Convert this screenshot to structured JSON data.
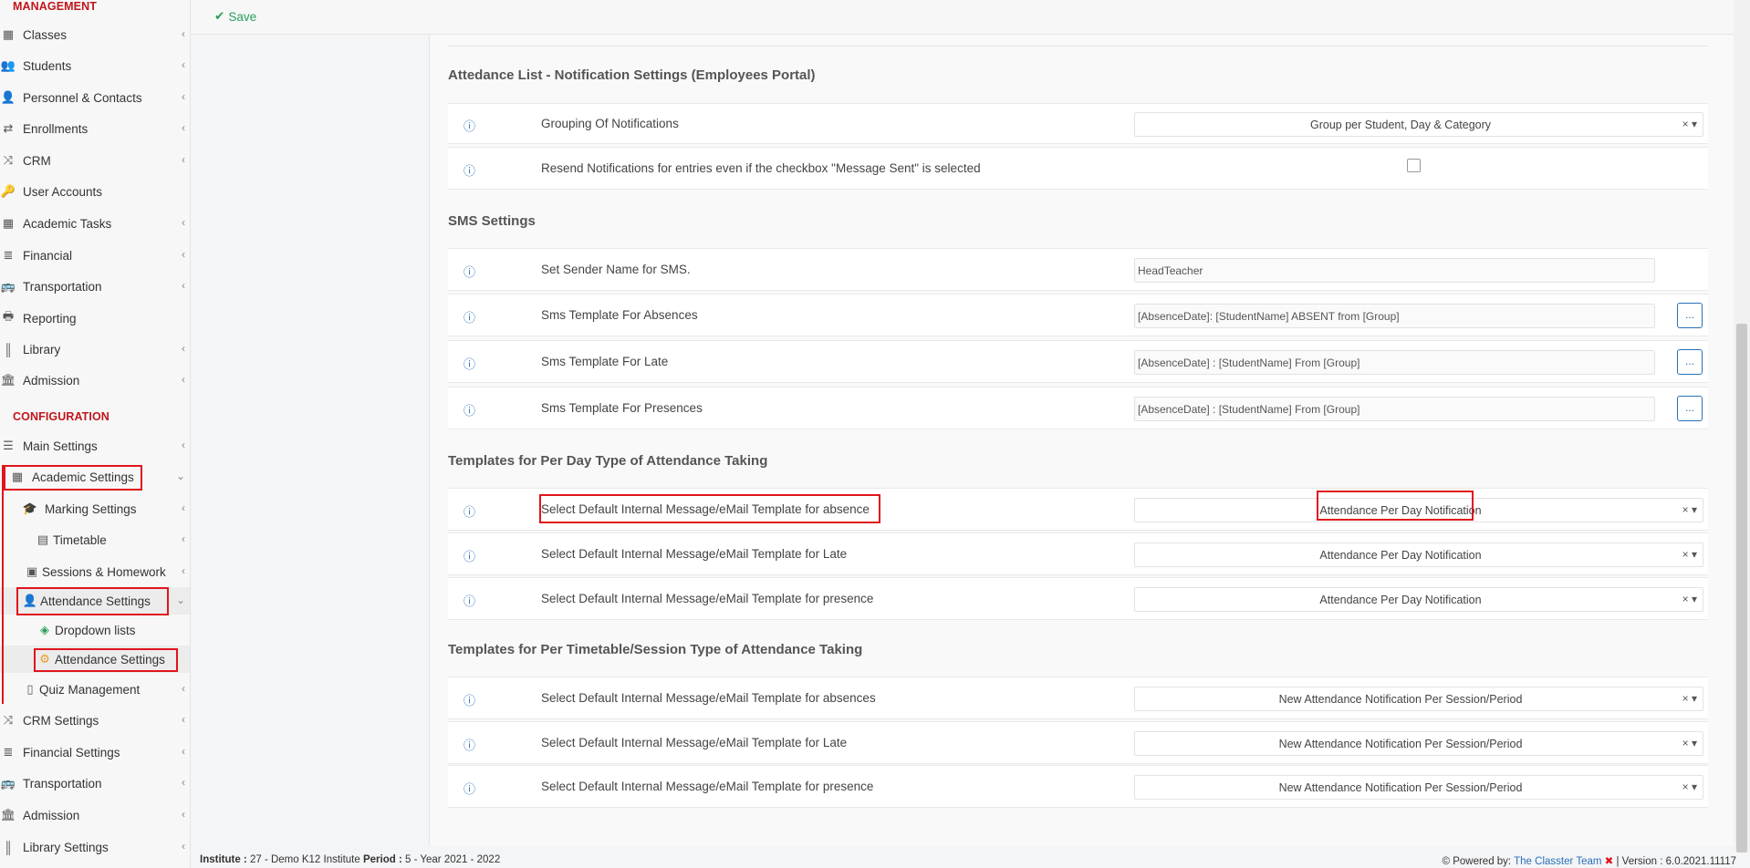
{
  "topbar": {
    "save_label": "Save"
  },
  "sidebar": {
    "management_title": "MANAGEMENT",
    "management_items": [
      {
        "label": "Classes"
      },
      {
        "label": "Students"
      },
      {
        "label": "Personnel & Contacts"
      },
      {
        "label": "Enrollments"
      },
      {
        "label": "CRM"
      },
      {
        "label": "User Accounts"
      },
      {
        "label": "Academic Tasks"
      },
      {
        "label": "Financial"
      },
      {
        "label": "Transportation"
      },
      {
        "label": "Reporting"
      },
      {
        "label": "Library"
      },
      {
        "label": "Admission"
      }
    ],
    "configuration_title": "CONFIGURATION",
    "configuration_items": [
      {
        "label": "Main Settings"
      },
      {
        "label": "Academic Settings"
      },
      {
        "label": "Marking Settings"
      },
      {
        "label": "Timetable"
      },
      {
        "label": "Sessions & Homework"
      },
      {
        "label": "Attendance Settings"
      },
      {
        "label": "Dropdown lists"
      },
      {
        "label": "Attendance Settings"
      },
      {
        "label": "Quiz Management"
      },
      {
        "label": "CRM Settings"
      },
      {
        "label": "Financial Settings"
      },
      {
        "label": "Transportation"
      },
      {
        "label": "Admission"
      },
      {
        "label": "Library Settings"
      }
    ]
  },
  "main": {
    "section_notifications": "Attedance List - Notification Settings (Employees Portal)",
    "grouping_label": "Grouping Of Notifications",
    "grouping_value": "Group per Student, Day & Category",
    "resend_label": "Resend Notifications for entries even if the checkbox \"Message Sent\" is selected",
    "section_sms": "SMS Settings",
    "sender_label": "Set Sender Name for SMS.",
    "sender_value": "HeadTeacher",
    "sms_absences_label": "Sms Template For Absences",
    "sms_absences_value": "[AbsenceDate]: [StudentName] ABSENT from [Group]",
    "sms_late_label": "Sms Template For Late",
    "sms_late_value": "[AbsenceDate] : [StudentName] From [Group]",
    "sms_presences_label": "Sms Template For Presences",
    "sms_presences_value": "[AbsenceDate] : [StudentName] From [Group]",
    "dots_label": "...",
    "section_per_day": "Templates for Per Day Type of Attendance Taking",
    "per_day_absence_label": "Select Default Internal Message/eMail Template for absence",
    "per_day_late_label": "Select Default Internal Message/eMail Template for Late",
    "per_day_presence_label": "Select Default Internal Message/eMail Template for presence",
    "per_day_value": "Attendance Per Day Notification",
    "section_per_session": "Templates for Per Timetable/Session Type of Attendance Taking",
    "per_session_absences_label": "Select Default Internal Message/eMail Template for absences",
    "per_session_late_label": "Select Default Internal Message/eMail Template for Late",
    "per_session_presence_label": "Select Default Internal Message/eMail Template for presence",
    "per_session_value": "New Attendance Notification Per Session/Period"
  },
  "footer": {
    "institute_label": "Institute :",
    "institute_value": "27 - Demo K12 Institute",
    "period_label": "Period :",
    "period_value": "5 - Year 2021 - 2022",
    "powered_by": "Powered by:",
    "team_name": "The Classter Team",
    "version": "| Version : 6.0.2021.11117"
  },
  "colors": {
    "accent_red": "#e0141c",
    "save_green": "#2a9d5c",
    "link_blue": "#2a6fb8"
  }
}
